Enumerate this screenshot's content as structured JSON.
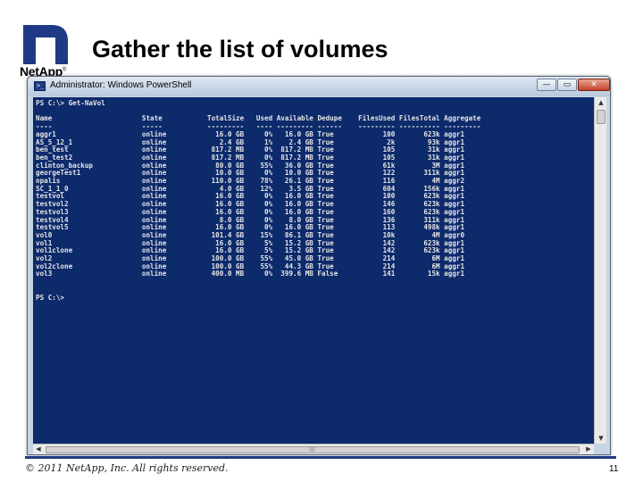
{
  "slide": {
    "title": "Gather the list of volumes",
    "logo_text": "NetApp",
    "logo_mark": "®",
    "copyright": "© 2011 NetApp, Inc. All rights reserved.",
    "page_number": "11"
  },
  "window": {
    "title": "Administrator: Windows PowerShell",
    "minimize_glyph": "—",
    "maximize_glyph": "▭",
    "close_glyph": "✕"
  },
  "console": {
    "prompt_command": "PS C:\\> Get-NaVol",
    "blank_line": "",
    "columns": [
      "Name",
      "State",
      "TotalSize",
      "Used",
      "Available",
      "Dedupe",
      "FilesUsed",
      "FilesTotal",
      "Aggregate"
    ],
    "rows": [
      [
        "aggr1",
        "online",
        "16.0 GB",
        "0%",
        "16.0 GB",
        "True",
        "100",
        "623k",
        "aggr1"
      ],
      [
        "AS_5_12_1",
        "online",
        "2.4 GB",
        "1%",
        "2.4 GB",
        "True",
        "2k",
        "93k",
        "aggr1"
      ],
      [
        "ben_test",
        "online",
        "817.2 MB",
        "0%",
        "817.2 MB",
        "True",
        "105",
        "31k",
        "aggr1"
      ],
      [
        "ben_test2",
        "online",
        "817.2 MB",
        "0%",
        "817.2 MB",
        "True",
        "105",
        "31k",
        "aggr1"
      ],
      [
        "clinton_backup",
        "online",
        "80.0 GB",
        "55%",
        "36.0 GB",
        "True",
        "61k",
        "3M",
        "aggr1"
      ],
      [
        "georgeTest1",
        "online",
        "10.0 GB",
        "0%",
        "10.0 GB",
        "True",
        "122",
        "311k",
        "aggr1"
      ],
      [
        "npalis",
        "online",
        "110.0 GB",
        "78%",
        "26.1 GB",
        "True",
        "116",
        "4M",
        "aggr2"
      ],
      [
        "SC_1_1_0",
        "online",
        "4.0 GB",
        "12%",
        "3.5 GB",
        "True",
        "604",
        "156k",
        "aggr1"
      ],
      [
        "testvol",
        "online",
        "16.0 GB",
        "0%",
        "16.0 GB",
        "True",
        "100",
        "623k",
        "aggr1"
      ],
      [
        "testvol2",
        "online",
        "16.0 GB",
        "0%",
        "16.0 GB",
        "True",
        "146",
        "623k",
        "aggr1"
      ],
      [
        "testvol3",
        "online",
        "16.0 GB",
        "0%",
        "16.0 GB",
        "True",
        "160",
        "623k",
        "aggr1"
      ],
      [
        "testvol4",
        "online",
        "8.0 GB",
        "0%",
        "8.0 GB",
        "True",
        "136",
        "311k",
        "aggr1"
      ],
      [
        "testvol5",
        "online",
        "16.0 GB",
        "0%",
        "16.0 GB",
        "True",
        "113",
        "498k",
        "aggr1"
      ],
      [
        "vol0",
        "online",
        "101.4 GB",
        "15%",
        "86.1 GB",
        "True",
        "10k",
        "4M",
        "aggr0"
      ],
      [
        "vol1",
        "online",
        "16.0 GB",
        "5%",
        "15.2 GB",
        "True",
        "142",
        "623k",
        "aggr1"
      ],
      [
        "vol1clone",
        "online",
        "16.0 GB",
        "5%",
        "15.2 GB",
        "True",
        "142",
        "623k",
        "aggr1"
      ],
      [
        "vol2",
        "online",
        "100.0 GB",
        "55%",
        "45.0 GB",
        "True",
        "214",
        "6M",
        "aggr1"
      ],
      [
        "vol2clone",
        "online",
        "100.0 GB",
        "55%",
        "44.3 GB",
        "True",
        "214",
        "6M",
        "aggr1"
      ],
      [
        "vol3",
        "online",
        "400.0 MB",
        "0%",
        "399.6 MB",
        "False",
        "141",
        "15k",
        "aggr1"
      ]
    ],
    "prompt_end": "PS C:\\>"
  },
  "colors": {
    "console_background": "#0d2a6b",
    "console_text": "#e6e6e6",
    "brand_blue": "#1f3a84"
  },
  "icons": {
    "window_icon": "powershell-icon",
    "logo": "netapp-logo"
  }
}
